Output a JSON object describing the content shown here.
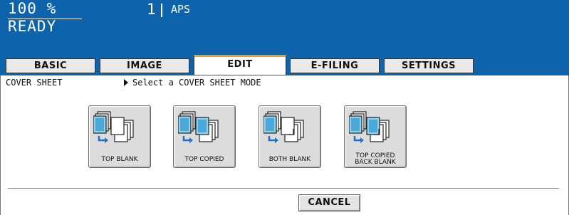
{
  "header": {
    "copies": "100 %",
    "counter": "1",
    "paper_size": "APS",
    "status": "READY"
  },
  "tabs": [
    {
      "label": "BASIC",
      "active": false
    },
    {
      "label": "IMAGE",
      "active": false
    },
    {
      "label": "EDIT",
      "active": true
    },
    {
      "label": "E-FILING",
      "active": false
    },
    {
      "label": "SETTINGS",
      "active": false
    }
  ],
  "content": {
    "function_label": "COVER SHEET",
    "guide": "Select a COVER SHEET MODE",
    "modes": [
      {
        "label": "TOP BLANK",
        "icon": "top-blank-icon"
      },
      {
        "label": "TOP COPIED",
        "icon": "top-copied-icon"
      },
      {
        "label": "BOTH BLANK",
        "icon": "both-blank-icon"
      },
      {
        "label_line1": "TOP COPIED",
        "label_line2": "BACK BLANK",
        "icon": "top-copied-back-blank-icon"
      }
    ],
    "cancel_label": "CANCEL"
  },
  "colors": {
    "header_bg": "#0d64aa",
    "active_tab_accent": "#f0a020",
    "button_bg": "#dcdcdc"
  }
}
